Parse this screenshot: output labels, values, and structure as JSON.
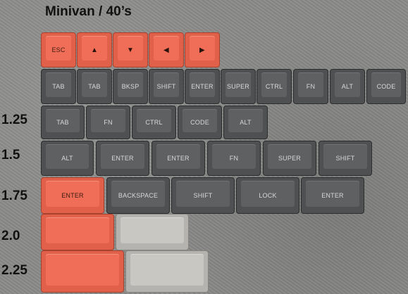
{
  "title": "Minivan / 40’s",
  "row_labels": [
    "1.25",
    "1.5",
    "1.75",
    "2.0",
    "2.25"
  ],
  "rows": {
    "row1": [
      {
        "label": "ESC",
        "color": "#e0604a"
      },
      {
        "label": "▲",
        "icon": "arrow-up-icon",
        "color": "#e0604a"
      },
      {
        "label": "▼",
        "icon": "arrow-down-icon",
        "color": "#e0604a"
      },
      {
        "label": "◀",
        "icon": "arrow-left-icon",
        "color": "#e0604a"
      },
      {
        "label": "▶",
        "icon": "arrow-right-icon",
        "color": "#e0604a"
      }
    ],
    "row2": [
      "TAB",
      "TAB",
      "BKSP",
      "SHIFT",
      "ENTER",
      "SUPER",
      "CTRL",
      "FN",
      "ALT",
      "CODE"
    ],
    "row_1_25": [
      "TAB",
      "FN",
      "CTRL",
      "CODE",
      "ALT"
    ],
    "row_1_5": [
      "ALT",
      "ENTER",
      "ENTER",
      "FN",
      "SUPER",
      "SHIFT"
    ],
    "row_1_75": [
      {
        "label": "ENTER",
        "color": "#e0604a"
      },
      {
        "label": "BACKSPACE",
        "color": "#4f5052"
      },
      {
        "label": "SHIFT",
        "color": "#4f5052"
      },
      {
        "label": "LOCK",
        "color": "#4f5052"
      },
      {
        "label": "ENTER",
        "color": "#4f5052"
      }
    ],
    "row_2_0": [
      {
        "label": "",
        "color": "#e0604a"
      },
      {
        "label": "",
        "color": "#b4b3af"
      }
    ],
    "row_2_25": [
      {
        "label": "",
        "color": "#e0604a"
      },
      {
        "label": "",
        "color": "#b4b3af"
      }
    ]
  }
}
